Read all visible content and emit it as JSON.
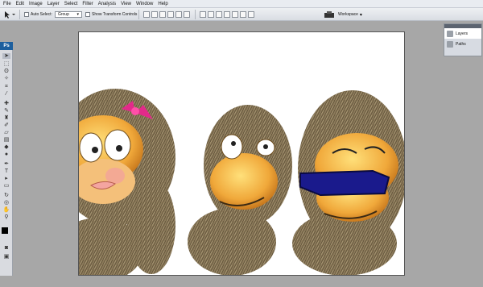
{
  "menu": [
    "File",
    "Edit",
    "Image",
    "Layer",
    "Select",
    "Filter",
    "Analysis",
    "View",
    "Window",
    "Help"
  ],
  "options": {
    "auto_select_label": "Auto Select:",
    "auto_select_value": "Group",
    "show_transform_label": "Show Transform Controls",
    "workspace_label": "Workspace"
  },
  "toolbox": {
    "logo": "Ps"
  },
  "panel": {
    "items": [
      "Layers",
      "Paths"
    ]
  },
  "colors": {
    "canvas_bg": "#ffffff",
    "app_bg": "#a7a7a7",
    "accent_blue": "#1d5f9e"
  }
}
